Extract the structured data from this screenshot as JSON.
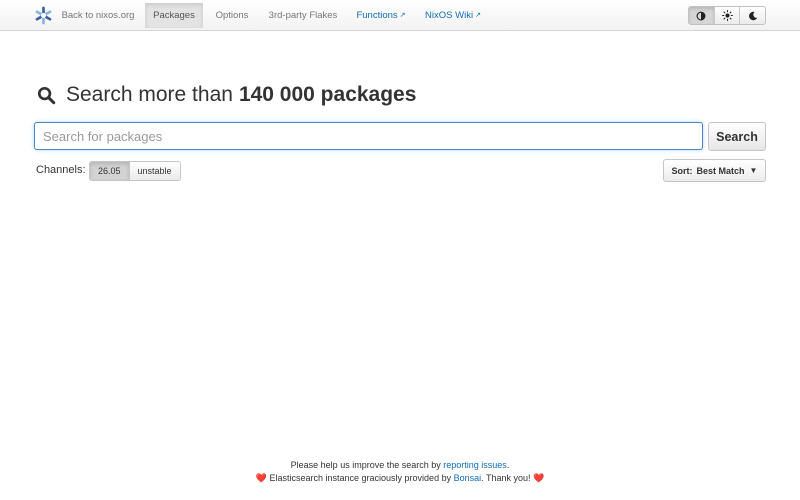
{
  "nav": {
    "back_label": "Back to nixos.org",
    "items": [
      {
        "label": "Packages",
        "active": true
      },
      {
        "label": "Options",
        "active": false
      },
      {
        "label": "3rd-party Flakes",
        "active": false
      }
    ],
    "external": [
      {
        "label": "Functions",
        "icon": "external-link-icon"
      },
      {
        "label": "NixOS Wiki",
        "icon": "external-link-icon"
      }
    ],
    "theme_buttons": [
      {
        "icon": "auto-theme-icon",
        "active": true
      },
      {
        "icon": "sun-icon",
        "active": false
      },
      {
        "icon": "moon-icon",
        "active": false
      }
    ]
  },
  "search": {
    "heading_prefix": "Search more than",
    "heading_count": "140 000 packages",
    "placeholder": "Search for packages",
    "value": "",
    "button_label": "Search"
  },
  "channels": {
    "label": "Channels:",
    "options": [
      {
        "label": "26.05",
        "active": true
      },
      {
        "label": "unstable",
        "active": false
      }
    ]
  },
  "sort": {
    "label": "Sort:",
    "value": "Best Match",
    "caret": "▼"
  },
  "footer": {
    "line1_prefix": "Please help us improve the search by",
    "line1_link": "reporting issues",
    "line1_suffix": ".",
    "heart": "❤️",
    "line2_prefix": "Elasticsearch instance graciously provided by",
    "line2_link": "Bonsai",
    "line2_suffix": ". Thank you!"
  },
  "colors": {
    "accent": "#0f6cb5",
    "logo_dark": "#415e9a",
    "logo_light": "#7eb8e2",
    "heart": "#e0245e"
  }
}
